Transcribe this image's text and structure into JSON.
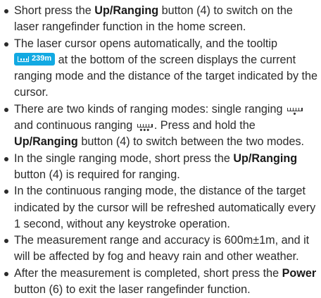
{
  "items": [
    {
      "t1": "Short press the ",
      "b1": "Up/Ranging",
      "t2": " button (4) to switch on the laser rangefinder function in the home screen."
    },
    {
      "t1": "The laser cursor opens automatically, and the tooltip ",
      "chip": "239m",
      "t2": " at the bottom of the screen displays the current ranging mode and the distance of the target indicated by the cursor."
    },
    {
      "t1": "There are two kinds of ranging modes: single ranging ",
      "single_icon": "•",
      "t2": " and continuous ranging ",
      "cont_icon": "•••",
      "t3": ". Press and hold the ",
      "b1": "Up/Ranging",
      "t4": " button (4) to switch between the two modes."
    },
    {
      "t1": "In the single ranging mode, short press the ",
      "b1": "Up/Ranging",
      "t2": " button (4) is required for ranging."
    },
    {
      "t1": "In the continuous ranging mode, the distance of the target indicated by the cursor will be refreshed automatically every 1 second, without any keystroke operation."
    },
    {
      "t1": "The measurement range and accuracy is 600m±1m, and it will be affected by fog and heavy rain and other weather."
    },
    {
      "t1": "After the  measurement is completed, short press the ",
      "b1": "Power",
      "t2": " button (6) to exit the laser rangefinder function."
    }
  ],
  "icons": {
    "chip_icon": "ruler-icon",
    "single_mode_icon": "single-ranging-icon",
    "continuous_mode_icon": "continuous-ranging-icon"
  },
  "colors": {
    "chip_bg": "#12a9e2",
    "text": "#2b2b2b"
  }
}
